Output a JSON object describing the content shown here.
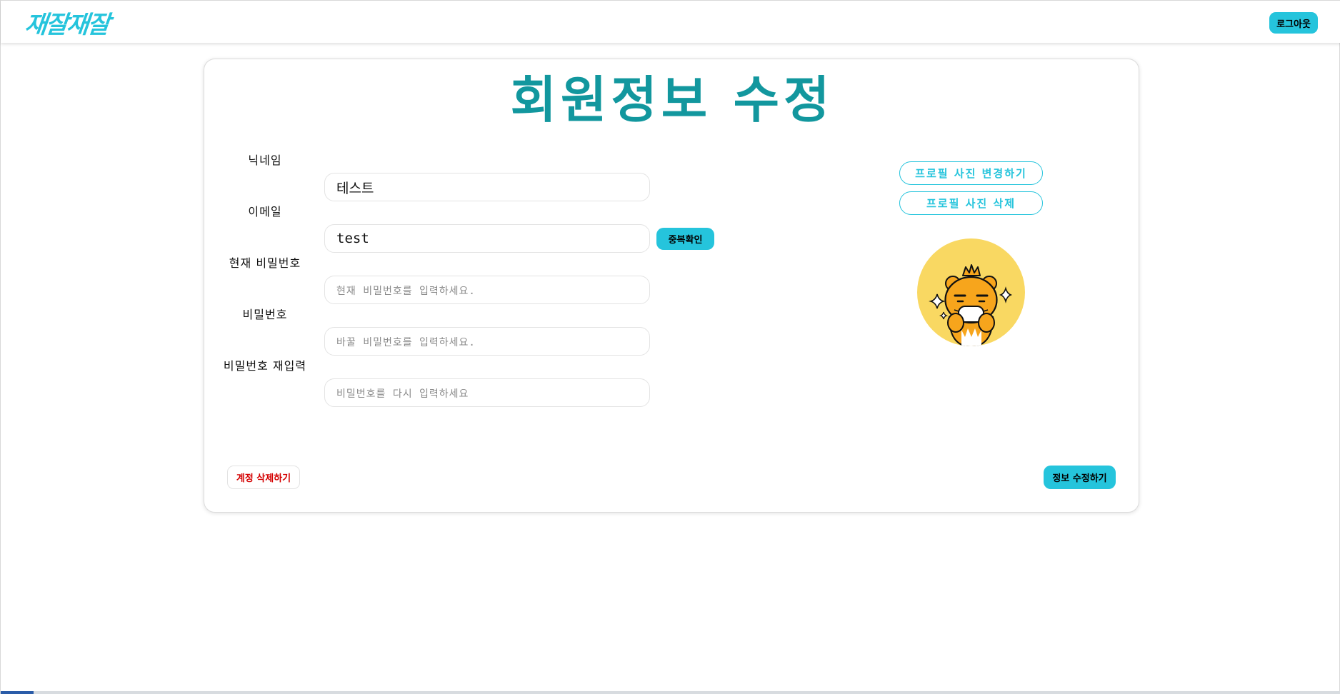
{
  "header": {
    "logo": "재잘재잘",
    "logout_label": "로그아웃"
  },
  "page": {
    "title": "회원정보 수정"
  },
  "form": {
    "nickname": {
      "label": "닉네임",
      "value": "테스트"
    },
    "email": {
      "label": "이메일",
      "value": "test",
      "check_label": "중복확인"
    },
    "current_password": {
      "label": "현재 비밀번호",
      "placeholder": "현재 비밀번호를 입력하세요."
    },
    "password": {
      "label": "비밀번호",
      "placeholder": "바꿀 비밀번호를 입력하세요."
    },
    "password_confirm": {
      "label": "비밀번호 재입력",
      "placeholder": "비밀번호를 다시 입력하세요"
    }
  },
  "profile": {
    "change_photo_label": "프로필 사진 변경하기",
    "delete_photo_label": "프로필 사진 삭제",
    "avatar_icon": "ryan-character-avatar"
  },
  "actions": {
    "delete_account_label": "계정 삭제하기",
    "save_label": "정보 수정하기"
  },
  "colors": {
    "accent": "#25c4dc",
    "title": "#12979e",
    "danger": "#d40000",
    "avatar_bg": "#f9d862"
  }
}
